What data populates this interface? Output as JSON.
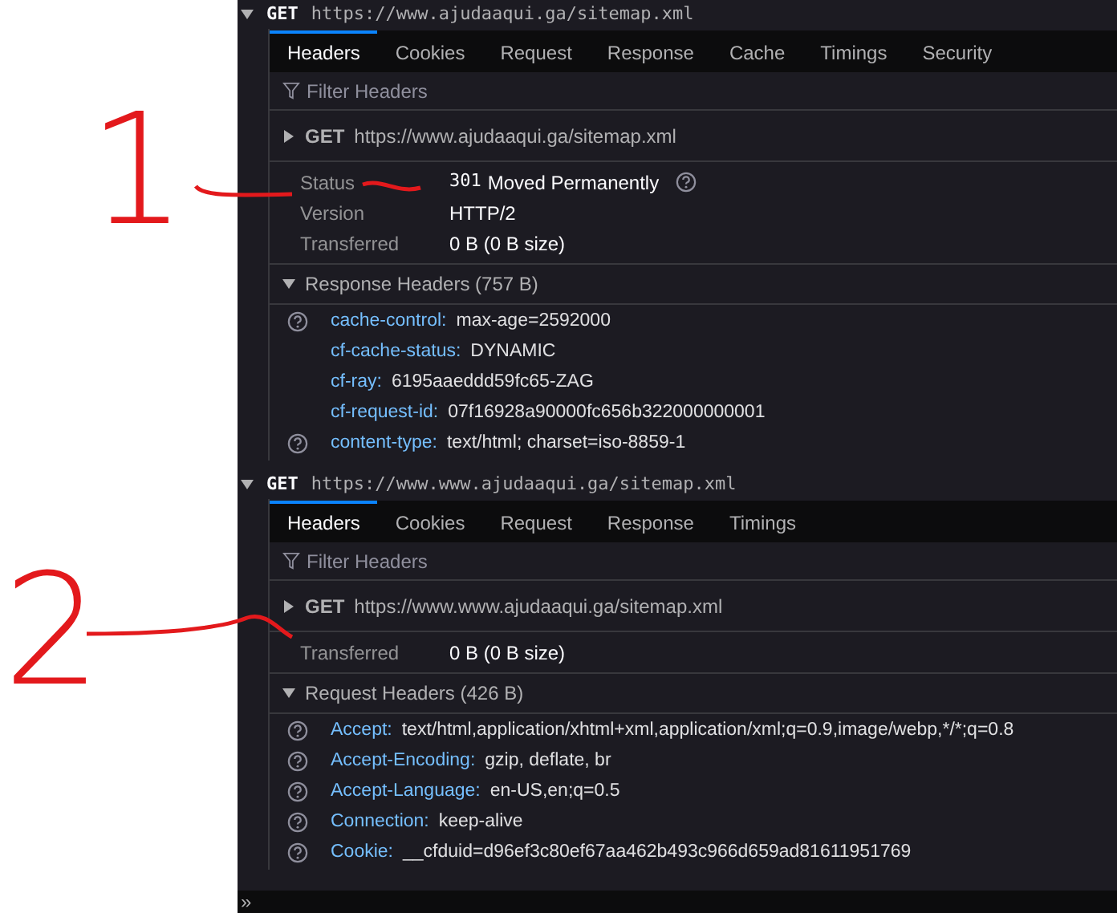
{
  "annotations": [
    {
      "label": "1"
    },
    {
      "label": "2"
    }
  ],
  "requests": [
    {
      "method": "GET",
      "url": "https://www.ajudaaqui.ga/sitemap.xml",
      "expanded": true,
      "tabs": [
        {
          "label": "Headers",
          "selected": true
        },
        {
          "label": "Cookies",
          "selected": false
        },
        {
          "label": "Request",
          "selected": false
        },
        {
          "label": "Response",
          "selected": false
        },
        {
          "label": "Cache",
          "selected": false
        },
        {
          "label": "Timings",
          "selected": false
        },
        {
          "label": "Security",
          "selected": false
        }
      ],
      "filter": {
        "placeholder": "Filter Headers"
      },
      "summary": {
        "method": "GET",
        "url": "https://www.ajudaaqui.ga/sitemap.xml",
        "expanded": false
      },
      "info": [
        {
          "label": "Status",
          "code": "301",
          "value": "Moved Permanently",
          "help": true
        },
        {
          "label": "Version",
          "value": "HTTP/2",
          "help": false
        },
        {
          "label": "Transferred",
          "value": "0 B (0 B size)",
          "help": false
        }
      ],
      "section": {
        "title": "Response Headers (757 B)",
        "expanded": true
      },
      "headers": [
        {
          "name": "cache-control:",
          "value": "max-age=2592000",
          "help": true
        },
        {
          "name": "cf-cache-status:",
          "value": "DYNAMIC",
          "help": false
        },
        {
          "name": "cf-ray:",
          "value": "6195aaeddd59fc65-ZAG",
          "help": false
        },
        {
          "name": "cf-request-id:",
          "value": "07f16928a90000fc656b322000000001",
          "help": false
        },
        {
          "name": "content-type:",
          "value": "text/html; charset=iso-8859-1",
          "help": true
        }
      ]
    },
    {
      "method": "GET",
      "url": "https://www.www.ajudaaqui.ga/sitemap.xml",
      "expanded": true,
      "tabs": [
        {
          "label": "Headers",
          "selected": true
        },
        {
          "label": "Cookies",
          "selected": false
        },
        {
          "label": "Request",
          "selected": false
        },
        {
          "label": "Response",
          "selected": false
        },
        {
          "label": "Timings",
          "selected": false
        }
      ],
      "filter": {
        "placeholder": "Filter Headers"
      },
      "summary": {
        "method": "GET",
        "url": "https://www.www.ajudaaqui.ga/sitemap.xml",
        "expanded": false
      },
      "info": [
        {
          "label": "Transferred",
          "value": "0 B (0 B size)",
          "help": false
        }
      ],
      "section": {
        "title": "Request Headers (426 B)",
        "expanded": true
      },
      "headers": [
        {
          "name": "Accept:",
          "value": "text/html,application/xhtml+xml,application/xml;q=0.9,image/webp,*/*;q=0.8",
          "help": true
        },
        {
          "name": "Accept-Encoding:",
          "value": "gzip, deflate, br",
          "help": true
        },
        {
          "name": "Accept-Language:",
          "value": "en-US,en;q=0.5",
          "help": true
        },
        {
          "name": "Connection:",
          "value": "keep-alive",
          "help": true
        },
        {
          "name": "Cookie:",
          "value": "__cfduid=d96ef3c80ef67aa462b493c966d659ad81611951769",
          "help": true
        }
      ]
    }
  ],
  "console": {
    "prompt": "»"
  }
}
